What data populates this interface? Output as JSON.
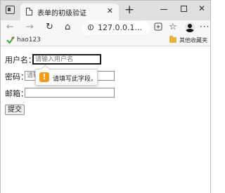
{
  "browser": {
    "tab": {
      "title": "表单的初级验证",
      "close_glyph": "✕"
    },
    "new_tab_glyph": "+",
    "window_controls": {
      "close_glyph": "✕"
    },
    "toolbar": {
      "back_glyph": "←",
      "forward_glyph": "→",
      "refresh_glyph": "↻",
      "home_glyph": "⌂",
      "address": "127.0.0.1...",
      "favorites_glyph": "☆",
      "more_glyph": "···"
    },
    "bookmarks": {
      "items": [
        {
          "label": "hao123",
          "icon": "hao123-icon"
        }
      ],
      "folder": {
        "label": "其他收藏夹",
        "icon": "folder-icon"
      }
    }
  },
  "form": {
    "username": {
      "label": "用户名：",
      "placeholder": "请输入用户名"
    },
    "password": {
      "label": "密码：",
      "placeholder": "请输入"
    },
    "email": {
      "label": "邮箱：",
      "placeholder": ""
    },
    "submit_label": "提交",
    "validation": {
      "message": "请填写此字段。",
      "icon": "warning-icon",
      "icon_glyph": "!",
      "color": "#f39a1b"
    }
  }
}
